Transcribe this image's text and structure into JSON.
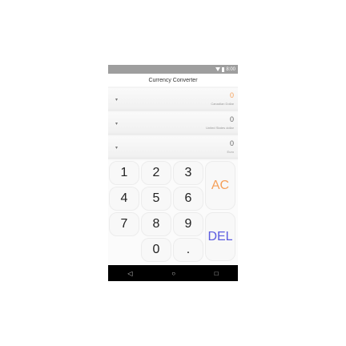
{
  "status": {
    "time": "8:00"
  },
  "title": "Currency Converter",
  "rows": [
    {
      "value": "0",
      "currency": "Canadian Dollar",
      "value_color": "#f5a05a"
    },
    {
      "value": "0",
      "currency": "United States dollar",
      "value_color": "#666666"
    },
    {
      "value": "0",
      "currency": "Euro",
      "value_color": "#666666"
    }
  ],
  "keys": {
    "k1": "1",
    "k2": "2",
    "k3": "3",
    "k4": "4",
    "k5": "5",
    "k6": "6",
    "k7": "7",
    "k8": "8",
    "k9": "9",
    "k0": "0",
    "dot": ".",
    "ac": "AC",
    "del": "DEL"
  },
  "nav": {
    "back": "◁",
    "home": "○",
    "recent": "□"
  }
}
